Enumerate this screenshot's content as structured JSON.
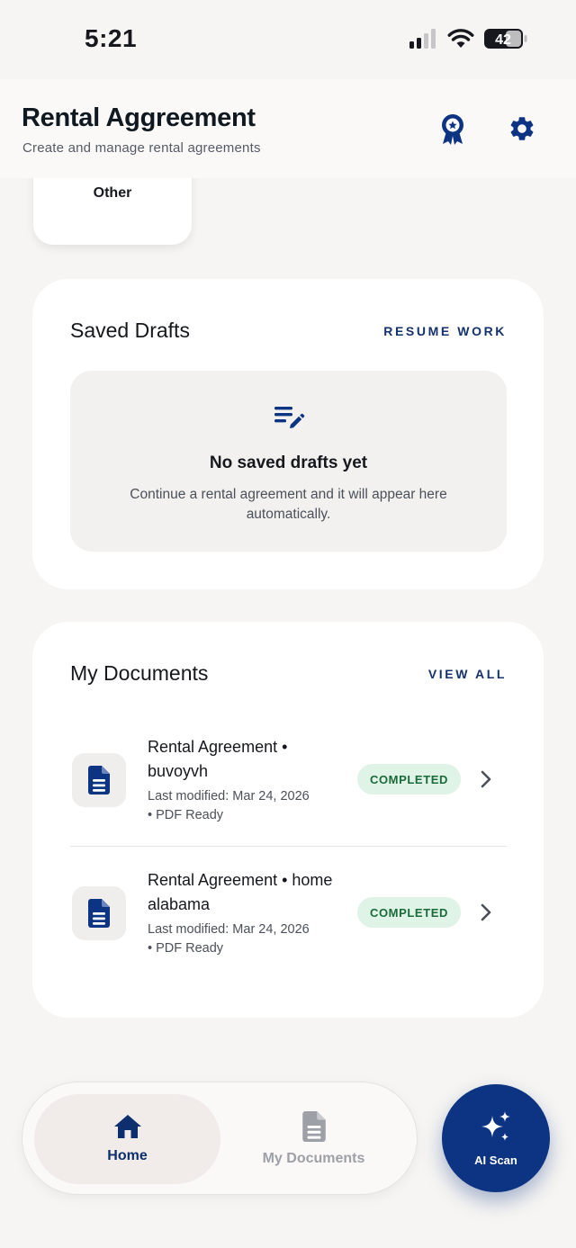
{
  "status_bar": {
    "time": "5:21",
    "battery": "42"
  },
  "header": {
    "title": "Rental Aggreement",
    "subtitle": "Create and manage rental agreements",
    "badge_icon": "award-badge-icon",
    "settings_icon": "gear-icon"
  },
  "category": {
    "label": "Other"
  },
  "drafts": {
    "title": "Saved Drafts",
    "link": "RESUME WORK",
    "empty_icon": "edit-notes-icon",
    "empty_title": "No saved drafts yet",
    "empty_text": "Continue a rental agreement and it will appear here automatically."
  },
  "documents": {
    "title": "My Documents",
    "link": "VIEW ALL",
    "items": [
      {
        "title": "Rental Agreement • buvoyvh",
        "modified": "Last modified: Mar 24, 2026",
        "format": "• PDF Ready",
        "status": "COMPLETED"
      },
      {
        "title": "Rental Agreement • home alabama",
        "modified": "Last modified: Mar 24, 2026",
        "format": "• PDF Ready",
        "status": "COMPLETED"
      }
    ]
  },
  "nav": {
    "home": "Home",
    "documents": "My Documents",
    "ai_scan": "AI Scan"
  },
  "colors": {
    "brand": "#0d3483",
    "accent_text": "#14326b",
    "success_bg": "#dff3e6",
    "success_text": "#1a6a3a",
    "background": "#f6f5f3"
  }
}
